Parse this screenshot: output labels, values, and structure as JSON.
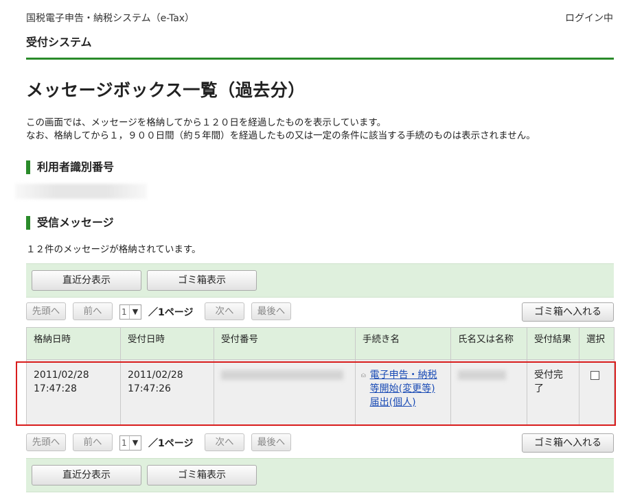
{
  "header": {
    "system_name": "国税電子申告・納税システム（e-Tax）",
    "login_status": "ログイン中",
    "subsystem": "受付システム"
  },
  "page": {
    "title": "メッセージボックス一覧（過去分）",
    "description_line1": "この画面では、メッセージを格納してから１２０日を経過したものを表示しています。",
    "description_line2": "なお、格納してから１，９００日間（約５年間）を経過したもの又は一定の条件に該当する手続のものは表示されません。"
  },
  "sections": {
    "user_id_heading": "利用者識別番号",
    "inbox_heading": "受信メッセージ",
    "message_count": "１２件のメッセージが格納されています。"
  },
  "actions": {
    "recent_label": "直近分表示",
    "trash_view_label": "ゴミ箱表示",
    "move_to_trash_label": "ゴミ箱へ入れる"
  },
  "pager": {
    "first": "先頭へ",
    "prev": "前へ",
    "next": "次へ",
    "last": "最後へ",
    "current_page": "1",
    "page_info": "／1ページ"
  },
  "table": {
    "columns": [
      "格納日時",
      "受付日時",
      "受付番号",
      "手続き名",
      "氏名又は名称",
      "受付結果",
      "選択"
    ],
    "rows": [
      {
        "stored_date": "2011/02/28",
        "stored_time": "17:47:28",
        "received_date": "2011/02/28",
        "received_time": "17:47:26",
        "procedure": "電子申告・納税等開始(変更等)届出(個人)",
        "result": "受付完了"
      }
    ]
  },
  "colors": {
    "accent_green": "#2a8b2a",
    "panel_green": "#dff0dd",
    "highlight_red": "#d81b1b",
    "link_blue": "#1a4bb5"
  }
}
